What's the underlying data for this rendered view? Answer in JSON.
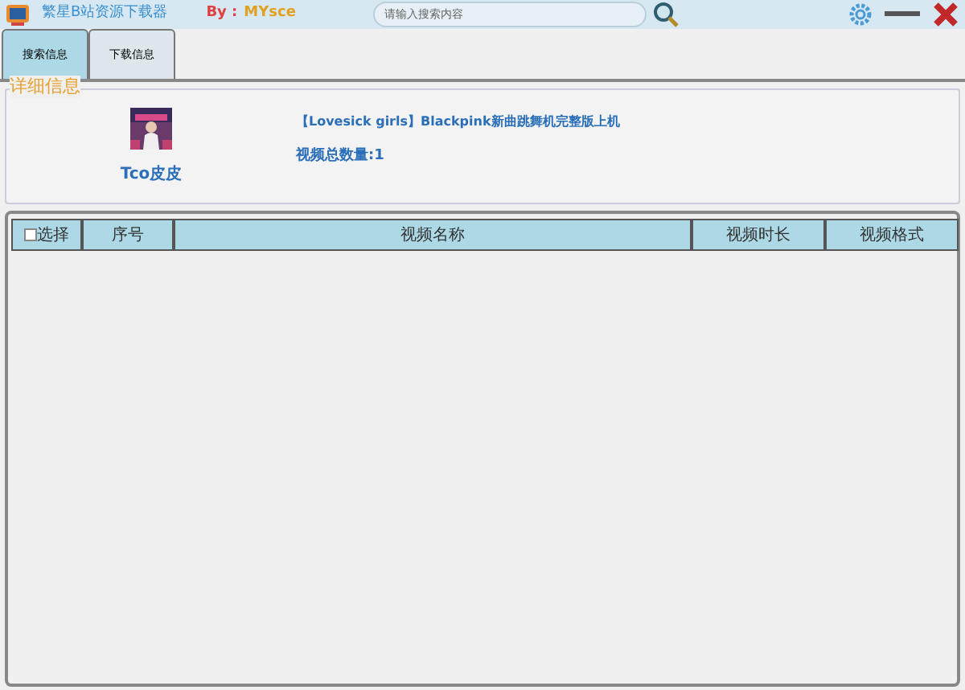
{
  "window": {
    "title": "繁星B站资源下载器",
    "author_label": "By :",
    "author": "MYsce"
  },
  "search": {
    "placeholder": "请输入搜索内容"
  },
  "tabs": [
    {
      "label": "搜索信息",
      "selected": true
    },
    {
      "label": "下载信息",
      "selected": false
    }
  ],
  "details": {
    "legend": "详细信息",
    "uploader": "Tco皮皮",
    "video_title": "【Lovesick girls】Blackpink新曲跳舞机完整版上机",
    "count": "视频总数量:1"
  },
  "table": {
    "select_all": {
      "label": "选择",
      "checked": false
    },
    "columns": [
      "序号",
      "视频名称",
      "视频时长",
      "视频格式"
    ]
  }
}
